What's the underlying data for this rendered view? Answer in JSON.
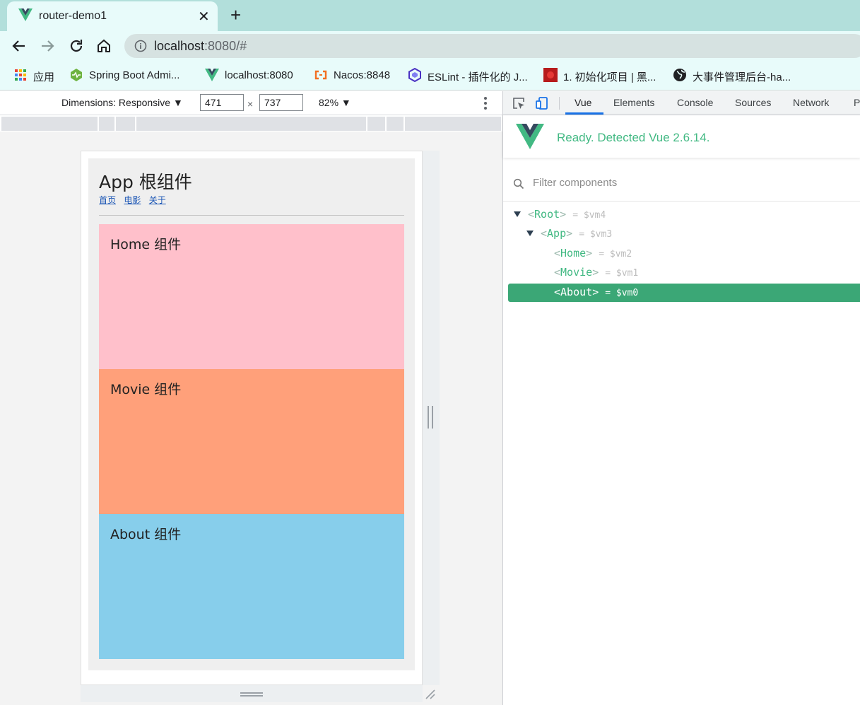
{
  "browser": {
    "tab": {
      "title": "router-demo1",
      "close_glyph": "✕"
    },
    "new_tab_glyph": "+",
    "url": {
      "host": "localhost",
      "rest": ":8080/#"
    },
    "bookmarks": [
      {
        "label": "应用",
        "icon": "apps-grid-icon"
      },
      {
        "label": "Spring Boot Admi...",
        "icon": "spring-boot-admin-icon"
      },
      {
        "label": "localhost:8080",
        "icon": "vue-logo-icon"
      },
      {
        "label": "Nacos:8848",
        "icon": "nacos-icon"
      },
      {
        "label": "ESLint - 插件化的 J...",
        "icon": "eslint-icon"
      },
      {
        "label": "1. 初始化项目 | 黑...",
        "icon": "heima-icon"
      },
      {
        "label": "大事件管理后台-ha...",
        "icon": "globe-icon"
      }
    ]
  },
  "device_toolbar": {
    "dimensions_label": "Dimensions: Responsive ▼",
    "width": "471",
    "times": "×",
    "height": "737",
    "zoom": "82% ▼"
  },
  "app": {
    "title": "App 根组件",
    "links": [
      "首页",
      "电影",
      "关于"
    ],
    "panels": {
      "home": "Home 组件",
      "movie": "Movie 组件",
      "about": "About 组件"
    },
    "colors": {
      "home": "#ffc0cb",
      "movie": "#ffa07a",
      "about": "#87ceeb"
    }
  },
  "devtools": {
    "tabs": [
      "Vue",
      "Elements",
      "Console",
      "Sources",
      "Network",
      "Pe"
    ],
    "active_tab": "Vue",
    "vue_status": "Ready. Detected Vue 2.6.14.",
    "filter_placeholder": "Filter components",
    "tree": [
      {
        "name": "Root",
        "ref": "= $vm4"
      },
      {
        "name": "App",
        "ref": "= $vm3"
      },
      {
        "name": "Home",
        "ref": "= $vm2"
      },
      {
        "name": "Movie",
        "ref": "= $vm1"
      },
      {
        "name": "About",
        "ref": "= $vm0",
        "selected": true
      }
    ],
    "accent": "#42b983",
    "selected_color": "#3ba776"
  }
}
